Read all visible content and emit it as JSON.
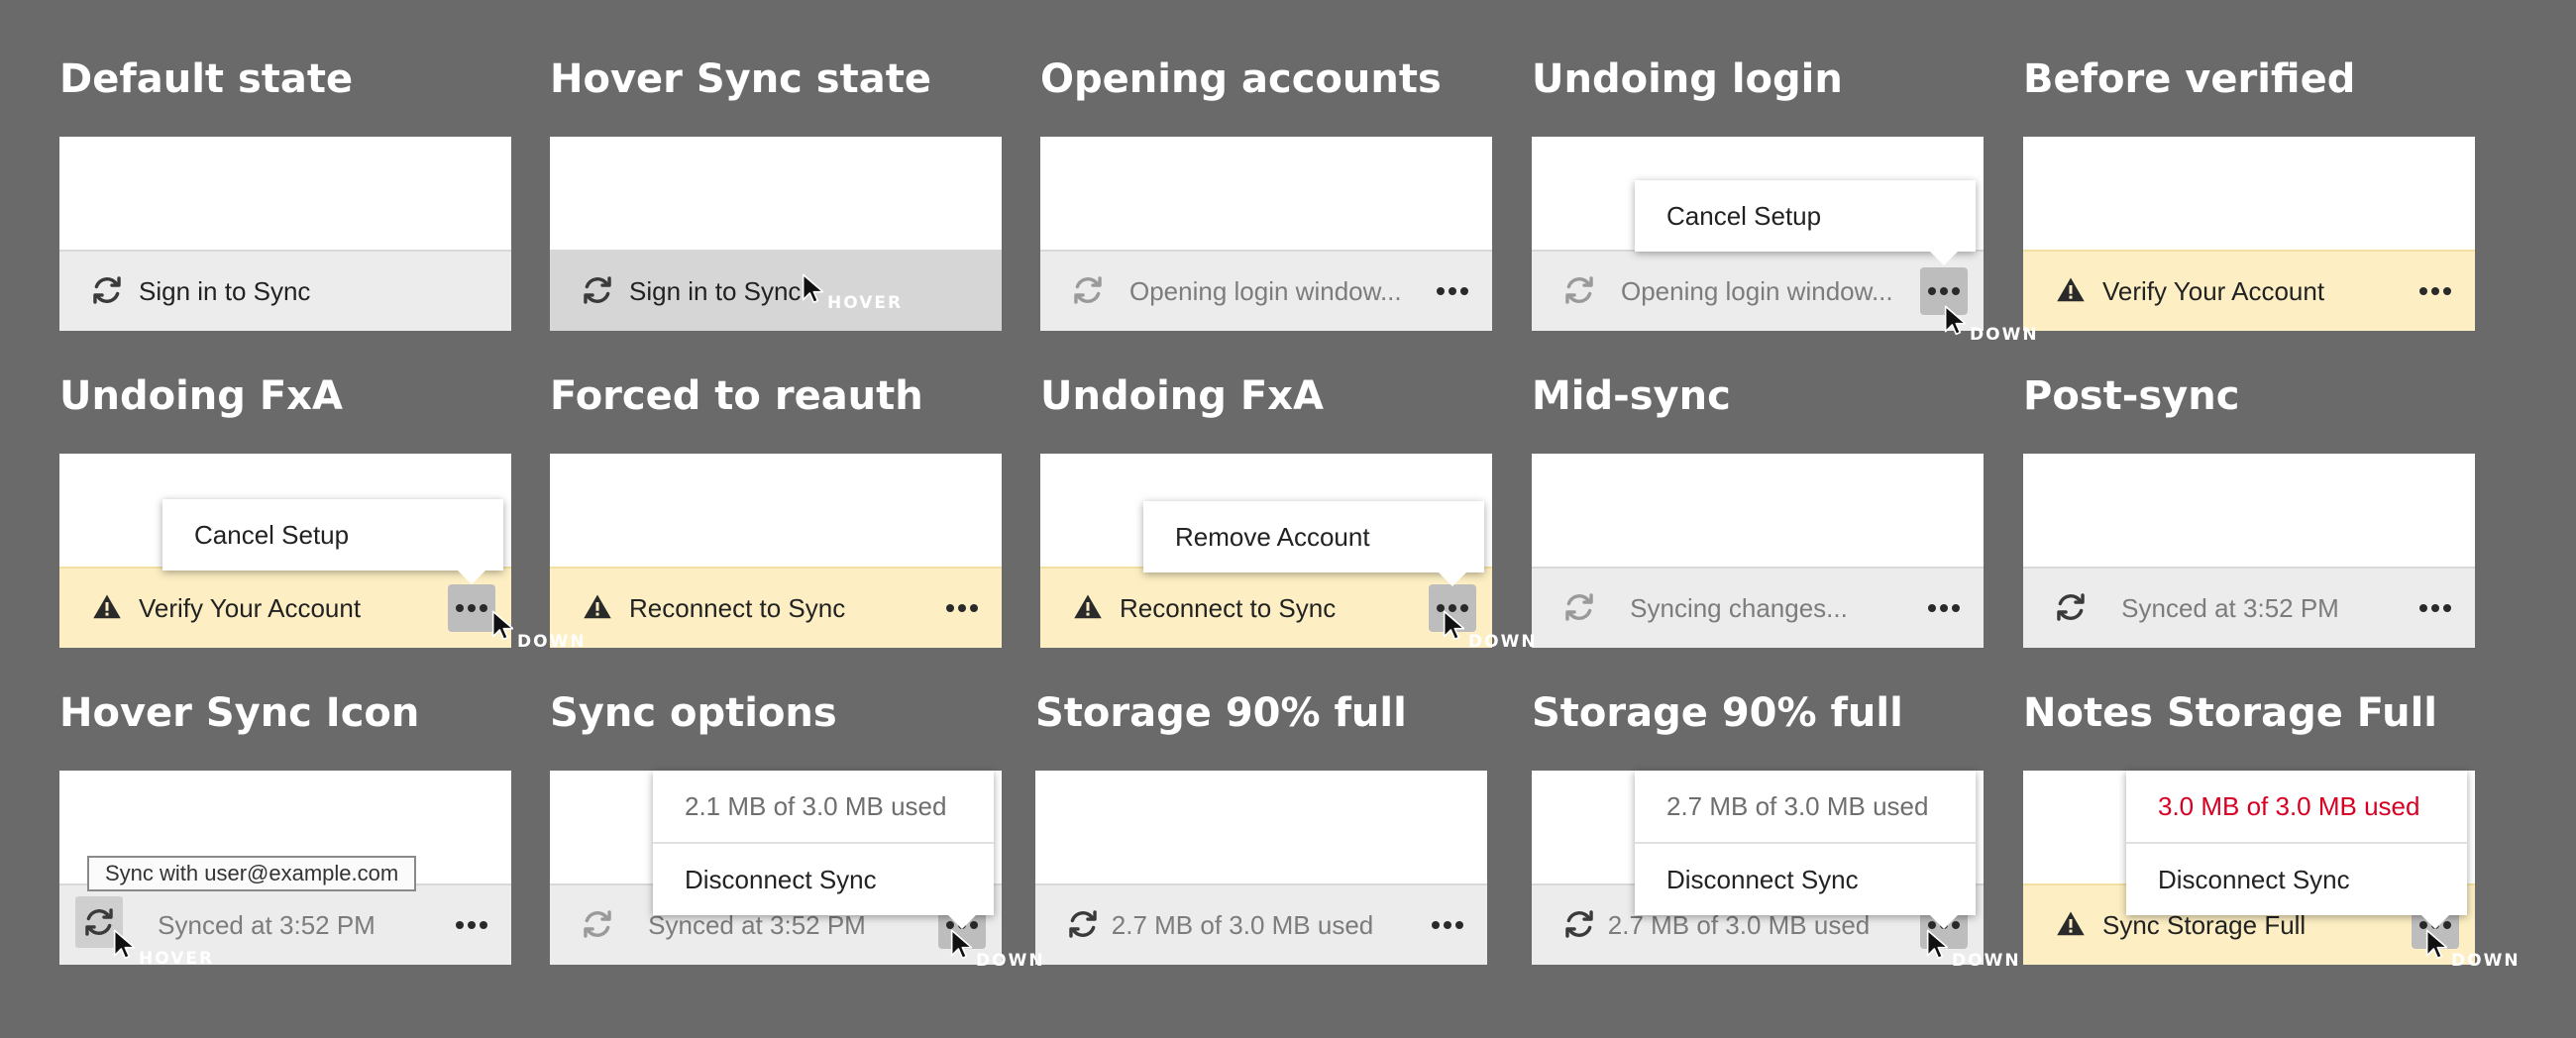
{
  "cells": [
    {
      "title": "Default state",
      "text": "Sign in to Sync"
    },
    {
      "title": "Hover Sync state",
      "text": "Sign in to Sync",
      "cursor_label": "HOVER"
    },
    {
      "title": "Opening accounts",
      "text": "Opening login window..."
    },
    {
      "title": "Undoing login",
      "text": "Opening login window...",
      "menu": [
        "Cancel Setup"
      ],
      "cursor_label": "DOWN"
    },
    {
      "title": "Before verified",
      "text": "Verify Your Account"
    },
    {
      "title": "Undoing FxA",
      "text": "Verify Your Account",
      "menu": [
        "Cancel Setup"
      ],
      "cursor_label": "DOWN"
    },
    {
      "title": "Forced to reauth",
      "text": "Reconnect to Sync"
    },
    {
      "title": "Undoing FxA",
      "text": "Reconnect to Sync",
      "menu": [
        "Remove Account"
      ],
      "cursor_label": "DOWN"
    },
    {
      "title": "Mid-sync",
      "text": "Syncing changes..."
    },
    {
      "title": "Post-sync",
      "text": "Synced at 3:52 PM"
    },
    {
      "title": "Hover Sync Icon",
      "text": "Synced at 3:52 PM",
      "tooltip": "Sync with user@example.com",
      "cursor_label": "HOVER"
    },
    {
      "title": "Sync options",
      "text": "Synced at 3:52 PM",
      "menu_status": "2.1 MB of 3.0 MB used",
      "menu": [
        "Disconnect Sync"
      ],
      "cursor_label": "DOWN"
    },
    {
      "title": "Storage 90% full",
      "text": "2.7 MB of 3.0 MB used"
    },
    {
      "title": "Storage 90% full",
      "text": "2.7 MB of 3.0 MB used",
      "menu_status": "2.7 MB of 3.0 MB used",
      "menu": [
        "Disconnect Sync"
      ],
      "cursor_label": "DOWN"
    },
    {
      "title": "Notes Storage Full",
      "text": "Sync Storage Full",
      "menu_status": "3.0 MB of 3.0 MB used",
      "menu": [
        "Disconnect Sync"
      ],
      "cursor_label": "DOWN"
    }
  ],
  "colors": {
    "background": "#6a6a6a",
    "warning": "#fdefc3",
    "footer": "#ececec",
    "error_text": "#d70022"
  },
  "icons": [
    "sync-icon",
    "warning-icon",
    "more-icon",
    "cursor-icon"
  ]
}
